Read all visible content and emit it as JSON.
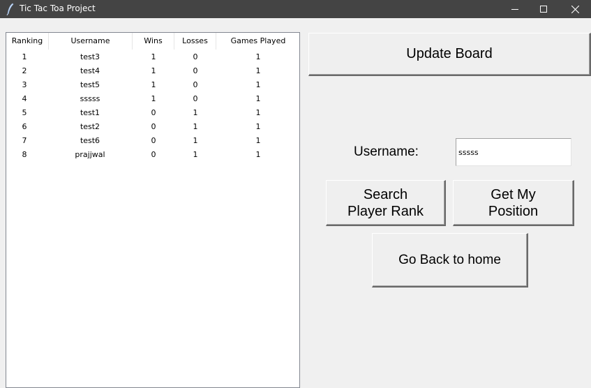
{
  "window": {
    "title": "Tic Tac Toa Project",
    "icon": "feather-icon",
    "controls": [
      "minimize-icon",
      "maximize-icon",
      "close-icon"
    ]
  },
  "leaderboard": {
    "columns": [
      "Ranking",
      "Username",
      "Wins",
      "Losses",
      "Games Played"
    ],
    "rows": [
      [
        "1",
        "test3",
        "1",
        "0",
        "1"
      ],
      [
        "2",
        "test4",
        "1",
        "0",
        "1"
      ],
      [
        "3",
        "test5",
        "1",
        "0",
        "1"
      ],
      [
        "4",
        "sssss",
        "1",
        "0",
        "1"
      ],
      [
        "5",
        "test1",
        "0",
        "1",
        "1"
      ],
      [
        "6",
        "test2",
        "0",
        "1",
        "1"
      ],
      [
        "7",
        "test6",
        "0",
        "1",
        "1"
      ],
      [
        "8",
        "prajjwal",
        "0",
        "1",
        "1"
      ]
    ]
  },
  "controls": {
    "update_label": "Update Board",
    "username_label": "Username:",
    "username_value": "sssss",
    "search_label": "Search\nPlayer Rank",
    "position_label": "Get My\nPosition",
    "home_label": "Go Back to home"
  }
}
